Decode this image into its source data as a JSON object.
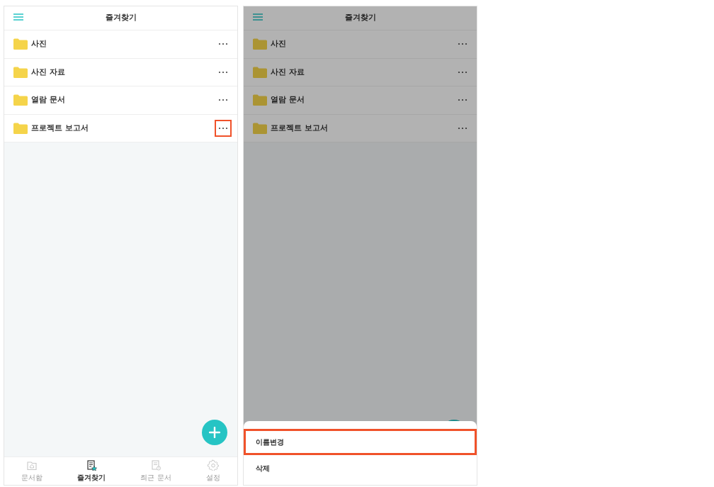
{
  "screens": [
    {
      "title": "즐겨찾기",
      "dimmed": false,
      "folders": [
        {
          "name": "사진",
          "highlighted": false
        },
        {
          "name": "사진 자료",
          "highlighted": false
        },
        {
          "name": "열람 문서",
          "highlighted": false
        },
        {
          "name": "프로젝트 보고서",
          "highlighted": true
        }
      ],
      "nav": [
        {
          "kind": "home",
          "label": "문서함",
          "selected": false
        },
        {
          "kind": "star",
          "label": "즐겨찾기",
          "selected": true
        },
        {
          "kind": "recent",
          "label": "최근 문서",
          "selected": false
        },
        {
          "kind": "settings",
          "label": "설정",
          "selected": false
        }
      ]
    },
    {
      "title": "즐겨찾기",
      "dimmed": true,
      "folders": [
        {
          "name": "사진",
          "highlighted": false
        },
        {
          "name": "사진 자료",
          "highlighted": false
        },
        {
          "name": "열람 문서",
          "highlighted": false
        },
        {
          "name": "프로젝트 보고서",
          "highlighted": false
        }
      ],
      "sheet": {
        "items": [
          {
            "label": "이름변경",
            "highlighted": true
          },
          {
            "label": "삭제",
            "highlighted": false
          }
        ]
      }
    }
  ]
}
